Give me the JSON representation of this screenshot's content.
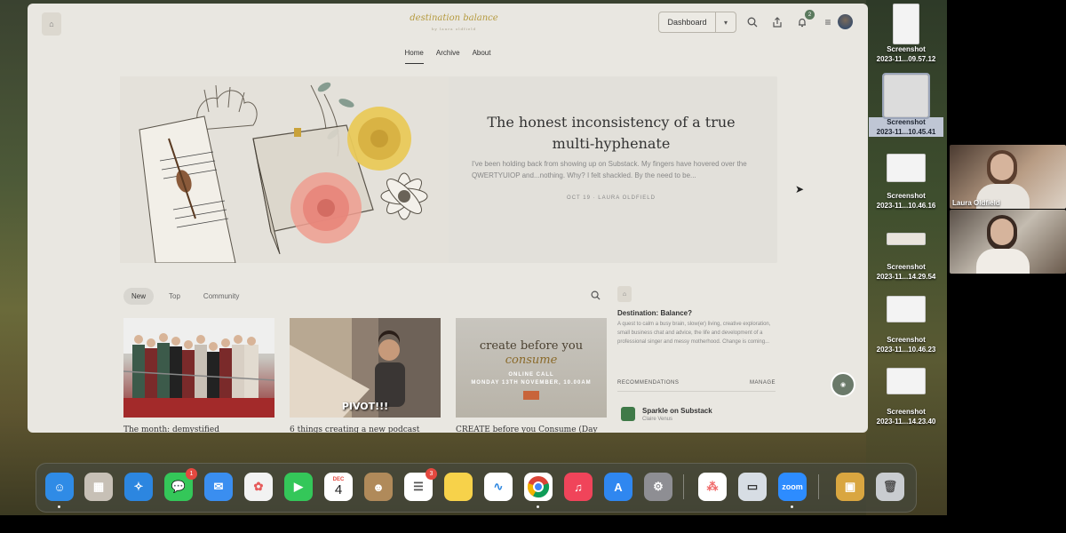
{
  "browser": {
    "brand_name": "destination balance",
    "brand_tagline": "by laura oldfield",
    "dashboard_label": "Dashboard",
    "notifications_count": "2",
    "nav": [
      {
        "label": "Home",
        "active": true
      },
      {
        "label": "Archive",
        "active": false
      },
      {
        "label": "About",
        "active": false
      }
    ]
  },
  "hero": {
    "title": "The honest inconsistency of a true multi-hyphenate",
    "excerpt": "I've been holding back from showing up on Substack. My fingers have hovered over the QWERTYUIOP and...nothing. Why? I felt shackled. By the need to be...",
    "meta": "OCT 19 · LAURA OLDFIELD"
  },
  "posts": {
    "tabs": [
      {
        "label": "New",
        "active": true
      },
      {
        "label": "Top",
        "active": false
      },
      {
        "label": "Community",
        "active": false
      }
    ],
    "cards": [
      {
        "title": "The month: demystified",
        "overlay": ""
      },
      {
        "title": "6 things creating a new podcast",
        "overlay": "PIVOT!!!"
      },
      {
        "title": "CREATE before you Consume (Day",
        "overlay": ""
      }
    ],
    "card3_heading_a": "create before you",
    "card3_heading_b": "consume",
    "card3_sub_a": "ONLINE CALL",
    "card3_sub_b": "MONDAY 13TH NOVEMBER, 10.00AM"
  },
  "sidebar": {
    "pub_title": "Destination: Balance?",
    "pub_description": "A quest to calm a busy brain, slow(er) living, creative exploration, small business chat and advice, the life and development of a professional singer and messy motherhood. Change is coming...",
    "recommendations_label": "RECOMMENDATIONS",
    "manage_label": "MANAGE",
    "rec_name": "Sparkle on Substack",
    "rec_author": "Claire Venus"
  },
  "desktop": {
    "files": [
      {
        "name": "Screenshot",
        "date": "2023-11...09.57.12",
        "selected": false
      },
      {
        "name": "Screenshot",
        "date": "2023-11...10.45.41",
        "selected": true
      },
      {
        "name": "Screenshot",
        "date": "2023-11...10.46.16",
        "selected": false
      },
      {
        "name": "Screenshot",
        "date": "2023-11...14.29.54",
        "selected": false
      },
      {
        "name": "Screenshot",
        "date": "2023-11...10.46.23",
        "selected": false
      },
      {
        "name": "Screenshot",
        "date": "2023-11...14.23.40",
        "selected": false
      }
    ]
  },
  "call": {
    "participant_name": "Laura Oldfield"
  },
  "dock": {
    "calendar_month": "DEC",
    "calendar_day": "4",
    "messages_badge": "1",
    "reminders_badge": "3",
    "zoom_label": "zoom",
    "colors": {
      "finder": "#2f8be6",
      "launchpad": "#c7c0b6",
      "safari": "#2c86e0",
      "messages": "#34c759",
      "mail": "#3a8ef0",
      "photos": "#f2f2f2",
      "facetime": "#34c759",
      "calendar": "#ffffff",
      "contacts": "#b08a5a",
      "reminders": "#ffffff",
      "notes": "#f7d24a",
      "freeform": "#ffffff",
      "chrome": "#ffffff",
      "music": "#f0445a",
      "appstore": "#2f87f0",
      "settings": "#8e8e93",
      "asana": "#ffffff",
      "preview": "#d7dde4",
      "zoom": "#2d8cff",
      "archive": "#d9a640",
      "trash": "#c9ccd0"
    }
  }
}
